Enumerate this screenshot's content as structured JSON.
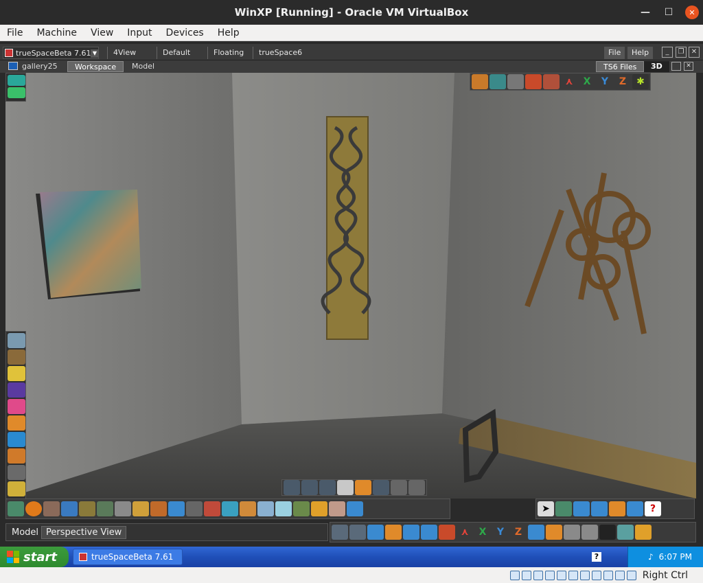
{
  "host": {
    "title": "WinXP [Running] - Oracle VM VirtualBox",
    "menu": [
      "File",
      "Machine",
      "View",
      "Input",
      "Devices",
      "Help"
    ],
    "host_key_label": "Right Ctrl"
  },
  "truespace": {
    "app_tab": "trueSpaceBeta 7.61",
    "layout_tabs": [
      "4View",
      "Default",
      "Floating",
      "trueSpace6"
    ],
    "right_buttons": {
      "file": "File",
      "help": "Help"
    },
    "scene_tab": "gallery25",
    "view_tabs": {
      "workspace": "Workspace",
      "model": "Model"
    },
    "ts6_files": "TS6 Files",
    "mode_3d": "3D",
    "axis_labels": {
      "x": "X",
      "y": "Y",
      "z": "Z"
    },
    "status_model": "Model",
    "status_view": "Perspective View"
  },
  "taskbar": {
    "start_label": "start",
    "task_label": "trueSpaceBeta 7.61",
    "clock": "6:07 PM"
  },
  "colors": {
    "xp_blue": "#245edb",
    "start_green": "#3c9b3c",
    "accent": "#e95420"
  }
}
